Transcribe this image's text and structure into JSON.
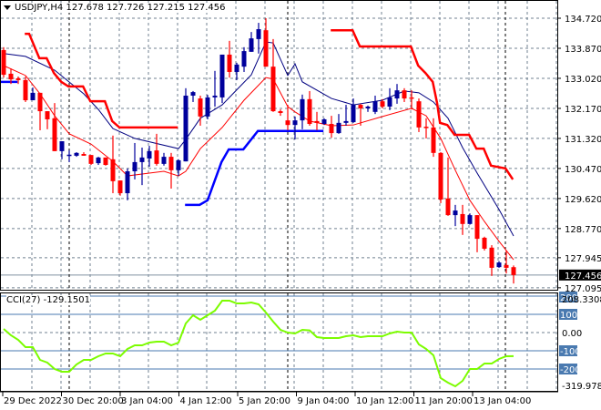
{
  "header": {
    "symbol": "USDJPY,H4",
    "open": "127.678",
    "high": "127.726",
    "low": "127.215",
    "close": "127.456"
  },
  "colors": {
    "bull": "#00009c",
    "bear": "#ff0000",
    "ma_fast": "#ff0000",
    "ma_slow": "#000080",
    "step_red": "#ff0000",
    "step_blue": "#0000ff",
    "cci": "#7cfc00",
    "grid": "#708090",
    "level": "#4a7ab0"
  },
  "price_axis": {
    "labels": [
      "134.720",
      "133.870",
      "133.020",
      "132.170",
      "131.320",
      "130.470",
      "129.620",
      "128.770",
      "127.945",
      "127.095"
    ],
    "current": "127.456"
  },
  "cci_panel": {
    "label": "CCI(27) -129.1501",
    "max_label": "208.3308",
    "min_label": "-319.9783",
    "levels": [
      "100",
      "-100",
      "-200"
    ],
    "zero_label": "0.00",
    "top_level": "200"
  },
  "time_axis": {
    "labels": [
      "29 Dec 2022",
      "30 Dec 20:00",
      "3 Jan 04:00",
      "4 Jan 12:00",
      "5 Jan 20:00",
      "9 Jan 04:00",
      "10 Jan 12:00",
      "11 Jan 20:00",
      "13 Jan 04:00"
    ]
  },
  "chart_data": {
    "type": "candlestick",
    "title": "USDJPY,H4",
    "ylim": [
      127.095,
      134.72
    ],
    "candles_ohlc": [
      [
        133.82,
        133.9,
        133.04,
        133.12
      ],
      [
        133.15,
        133.3,
        132.86,
        132.99
      ],
      [
        133.02,
        133.07,
        132.86,
        132.97
      ],
      [
        132.97,
        133.07,
        132.35,
        132.4
      ],
      [
        132.4,
        132.76,
        132.4,
        132.61
      ],
      [
        132.61,
        132.61,
        131.55,
        132.09
      ],
      [
        132.09,
        132.09,
        131.58,
        131.86
      ],
      [
        131.89,
        132.32,
        130.96,
        130.96
      ],
      [
        130.96,
        131.24,
        130.73,
        131.24
      ],
      [
        130.85,
        130.98,
        130.65,
        130.86
      ],
      [
        130.83,
        130.93,
        130.8,
        130.91
      ],
      [
        130.88,
        130.93,
        130.83,
        130.83
      ],
      [
        130.85,
        130.85,
        130.57,
        130.6
      ],
      [
        130.62,
        130.8,
        130.57,
        130.78
      ],
      [
        130.78,
        130.78,
        130.55,
        130.57
      ],
      [
        130.73,
        131.4,
        129.77,
        130.11
      ],
      [
        130.13,
        130.13,
        129.7,
        129.77
      ],
      [
        129.77,
        130.47,
        129.57,
        130.39
      ],
      [
        130.39,
        131.19,
        130.16,
        130.65
      ],
      [
        130.65,
        131.06,
        130.0,
        130.78
      ],
      [
        130.75,
        131.11,
        130.52,
        130.96
      ],
      [
        130.98,
        131.45,
        130.55,
        130.6
      ],
      [
        130.6,
        130.91,
        130.55,
        130.8
      ],
      [
        130.8,
        130.91,
        129.9,
        130.42
      ],
      [
        130.42,
        130.73,
        130.26,
        130.7
      ],
      [
        130.67,
        132.74,
        130.67,
        132.53
      ],
      [
        132.53,
        132.66,
        132.35,
        132.63
      ],
      [
        132.45,
        132.53,
        131.68,
        131.94
      ],
      [
        131.94,
        132.55,
        131.86,
        132.48
      ],
      [
        132.48,
        133.23,
        132.22,
        132.53
      ],
      [
        132.48,
        133.69,
        132.32,
        133.69
      ],
      [
        133.69,
        134.08,
        133.04,
        133.2
      ],
      [
        133.2,
        133.46,
        132.97,
        133.41
      ],
      [
        133.35,
        133.9,
        133.2,
        133.79
      ],
      [
        133.77,
        134.33,
        133.77,
        134.15
      ],
      [
        134.13,
        134.59,
        133.72,
        134.41
      ],
      [
        134.38,
        134.72,
        133.35,
        133.35
      ],
      [
        133.35,
        134.13,
        132.07,
        132.09
      ],
      [
        132.09,
        132.14,
        131.96,
        132.04
      ],
      [
        131.83,
        132.27,
        131.55,
        131.7
      ],
      [
        131.7,
        131.94,
        131.29,
        131.83
      ],
      [
        131.83,
        132.56,
        131.58,
        132.43
      ],
      [
        132.43,
        132.66,
        131.68,
        131.73
      ],
      [
        131.81,
        132.07,
        131.55,
        131.76
      ],
      [
        131.73,
        131.89,
        131.7,
        131.86
      ],
      [
        131.73,
        131.96,
        131.34,
        131.47
      ],
      [
        131.47,
        132.01,
        131.45,
        131.76
      ],
      [
        131.76,
        132.27,
        131.68,
        131.81
      ],
      [
        131.78,
        132.45,
        131.76,
        132.27
      ],
      [
        132.27,
        132.3,
        131.68,
        132.17
      ],
      [
        132.17,
        132.25,
        132.07,
        132.22
      ],
      [
        132.07,
        132.53,
        132.01,
        132.37
      ],
      [
        132.37,
        132.43,
        132.17,
        132.22
      ],
      [
        132.22,
        132.74,
        132.12,
        132.48
      ],
      [
        132.45,
        132.86,
        132.3,
        132.68
      ],
      [
        132.68,
        132.74,
        132.35,
        132.45
      ],
      [
        132.48,
        132.68,
        132.14,
        132.45
      ],
      [
        132.37,
        132.45,
        131.5,
        131.63
      ],
      [
        131.65,
        131.89,
        131.32,
        131.63
      ],
      [
        131.63,
        131.89,
        130.8,
        130.91
      ],
      [
        130.91,
        130.93,
        129.49,
        129.59
      ],
      [
        129.62,
        130.78,
        129.13,
        129.15
      ],
      [
        129.15,
        129.44,
        128.84,
        129.28
      ],
      [
        129.18,
        129.44,
        128.59,
        128.9
      ],
      [
        128.9,
        129.2,
        128.88,
        129.15
      ],
      [
        129.15,
        129.15,
        128.1,
        128.48
      ],
      [
        128.51,
        128.54,
        128.15,
        128.2
      ],
      [
        128.23,
        128.3,
        127.43,
        127.66
      ],
      [
        127.68,
        127.85,
        127.66,
        127.81
      ],
      [
        127.74,
        128.15,
        127.5,
        127.66
      ],
      [
        127.678,
        127.726,
        127.215,
        127.456
      ]
    ],
    "ma_slow": [
      [
        0,
        133.72
      ],
      [
        3,
        133.64
      ],
      [
        7,
        133.25
      ],
      [
        11,
        132.58
      ],
      [
        13,
        132.14
      ],
      [
        15,
        131.6
      ],
      [
        18,
        131.32
      ],
      [
        24,
        131.03
      ],
      [
        25,
        131.29
      ],
      [
        27,
        131.89
      ],
      [
        30,
        132.27
      ],
      [
        34,
        133.12
      ],
      [
        36,
        134.05
      ],
      [
        37,
        134.02
      ],
      [
        39,
        133.1
      ],
      [
        40,
        133.43
      ],
      [
        41,
        132.92
      ],
      [
        45,
        132.45
      ],
      [
        48,
        132.27
      ],
      [
        52,
        132.4
      ],
      [
        55,
        132.66
      ],
      [
        57,
        132.61
      ],
      [
        59,
        132.35
      ],
      [
        61,
        131.89
      ],
      [
        63,
        131.06
      ],
      [
        65,
        130.34
      ],
      [
        68,
        129.31
      ],
      [
        70,
        128.56
      ]
    ],
    "ma_fast": [
      [
        0,
        133.38
      ],
      [
        3,
        133.1
      ],
      [
        5,
        132.58
      ],
      [
        7,
        131.96
      ],
      [
        9,
        131.45
      ],
      [
        12,
        131.16
      ],
      [
        15,
        130.67
      ],
      [
        17,
        130.26
      ],
      [
        20,
        130.34
      ],
      [
        22,
        130.39
      ],
      [
        24,
        130.26
      ],
      [
        25,
        130.39
      ],
      [
        27,
        131.03
      ],
      [
        30,
        131.63
      ],
      [
        33,
        132.4
      ],
      [
        36,
        133.04
      ],
      [
        37,
        133.0
      ],
      [
        39,
        132.22
      ],
      [
        40,
        132.07
      ],
      [
        42,
        131.81
      ],
      [
        45,
        131.68
      ],
      [
        48,
        131.7
      ],
      [
        52,
        131.94
      ],
      [
        56,
        132.17
      ],
      [
        58,
        131.96
      ],
      [
        60,
        131.32
      ],
      [
        62,
        130.42
      ],
      [
        64,
        129.57
      ],
      [
        66,
        128.97
      ],
      [
        68,
        128.41
      ],
      [
        70,
        127.89
      ]
    ],
    "step_red": [
      [
        [
          2.9,
          134.28
        ],
        [
          3.5,
          134.28
        ],
        [
          4.9,
          133.59
        ],
        [
          5.9,
          133.59
        ],
        [
          6.9,
          133.17
        ],
        [
          7.9,
          132.92
        ],
        [
          8.9,
          132.79
        ],
        [
          10.9,
          132.79
        ],
        [
          11.9,
          132.37
        ],
        [
          13.9,
          132.37
        ],
        [
          14.9,
          131.81
        ],
        [
          15.9,
          131.63
        ],
        [
          23.9,
          131.63
        ]
      ],
      [
        [
          44.9,
          134.38
        ],
        [
          47.9,
          134.38
        ],
        [
          48.9,
          133.92
        ],
        [
          55.9,
          133.92
        ],
        [
          56.9,
          133.38
        ],
        [
          57.9,
          133.17
        ],
        [
          58.9,
          132.92
        ],
        [
          59.5,
          132.32
        ],
        [
          59.9,
          131.76
        ],
        [
          60.9,
          131.7
        ],
        [
          61.9,
          131.42
        ],
        [
          63.9,
          131.42
        ],
        [
          64.9,
          131.03
        ],
        [
          65.9,
          131.03
        ],
        [
          66.9,
          130.55
        ],
        [
          68.9,
          130.47
        ],
        [
          69.9,
          130.16
        ]
      ]
    ],
    "step_blue": [
      [
        [
          -0.5,
          132.92
        ],
        [
          1.9,
          132.92
        ]
      ],
      [
        [
          24.9,
          129.44
        ],
        [
          26.9,
          129.44
        ],
        [
          28,
          129.57
        ],
        [
          29.9,
          130.65
        ],
        [
          30.9,
          131.01
        ],
        [
          32.9,
          131.01
        ],
        [
          34.9,
          131.53
        ],
        [
          43.9,
          131.53
        ]
      ]
    ],
    "cci": [
      20,
      -15,
      -40,
      -80,
      -80,
      -150,
      -165,
      -200,
      -215,
      -215,
      -175,
      -150,
      -150,
      -130,
      -115,
      -115,
      -130,
      -90,
      -70,
      -70,
      -55,
      -50,
      -50,
      -70,
      -55,
      50,
      95,
      70,
      95,
      120,
      175,
      175,
      160,
      160,
      165,
      155,
      110,
      60,
      15,
      0,
      -5,
      15,
      12,
      -25,
      -30,
      -30,
      -30,
      -20,
      -15,
      -25,
      -20,
      -20,
      -20,
      -5,
      5,
      0,
      0,
      -65,
      -90,
      -125,
      -250,
      -275,
      -295,
      -265,
      -200,
      -200,
      -170,
      -170,
      -145,
      -130,
      -129.15
    ],
    "cci_range": [
      -319.9783,
      208.3308
    ]
  }
}
